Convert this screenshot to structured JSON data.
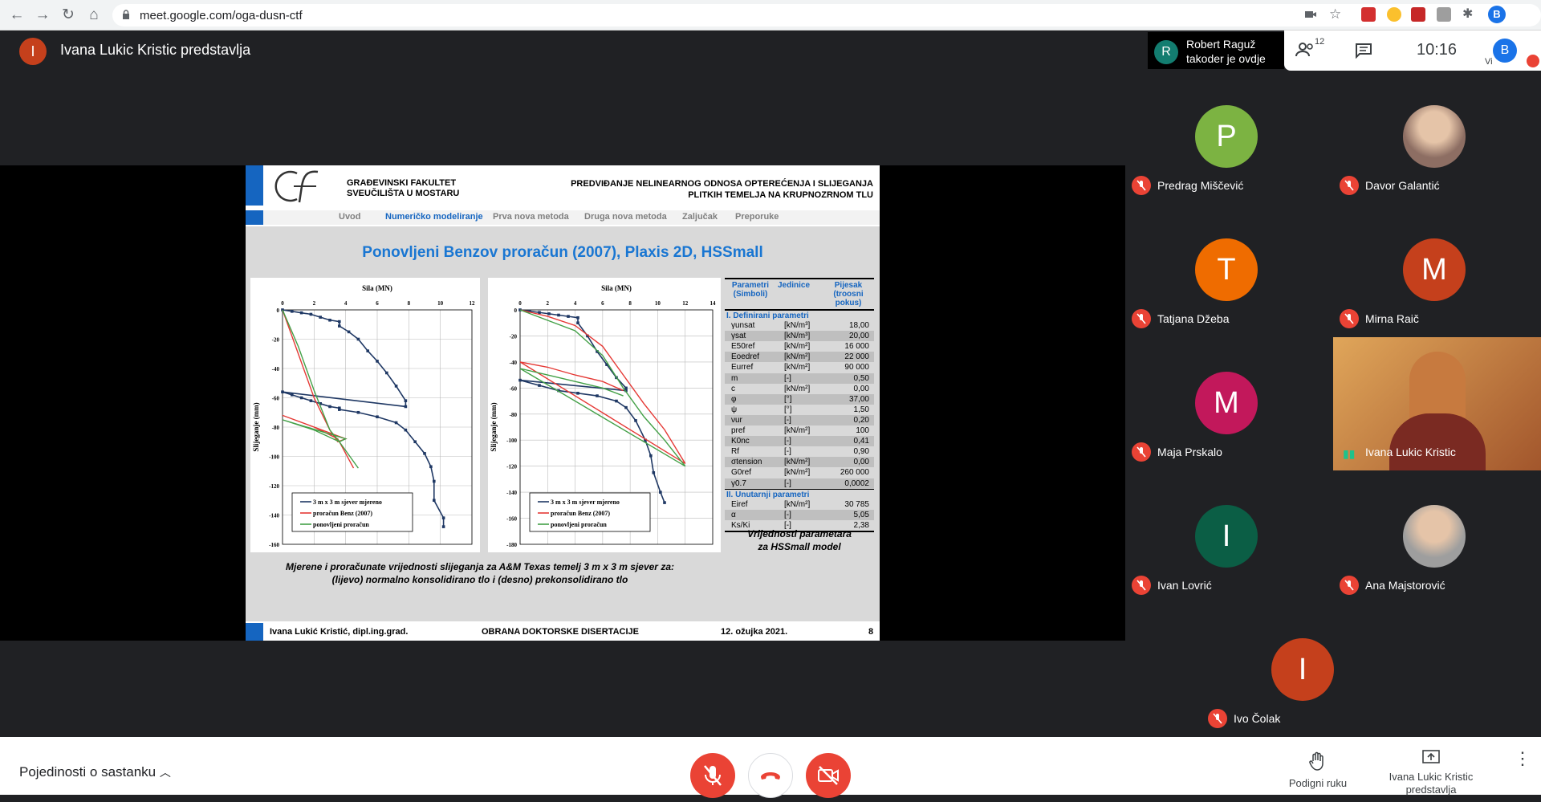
{
  "browser": {
    "url": "meet.google.com/oga-dusn-ctf",
    "profile": "B"
  },
  "presenter": {
    "initial": "I",
    "label": "Ivana Lukic Kristic predstavlja"
  },
  "notification": {
    "initial": "R",
    "name": "Robert Raguž",
    "text": "takoder je ovdje"
  },
  "topbar": {
    "people_count": "12",
    "clock": "10:16",
    "self_initial": "B",
    "self_label": "Vi"
  },
  "slide": {
    "faculty_line1": "GRAĐEVINSKI FAKULTET",
    "faculty_line2": "SVEUČILIŠTA U MOSTARU",
    "title_line1": "PREDVIĐANJE NELINEARNOG ODNOSA OPTEREĆENJA I SLIJEGANJA",
    "title_line2": "PLITKIH TEMELJA NA KRUPNOZRNOM TLU",
    "menu": [
      "Uvod",
      "Numeričko modeliranje",
      "Prva nova metoda",
      "Druga nova metoda",
      "Zaljučak",
      "Preporuke"
    ],
    "heading": "Ponovljeni Benzov proračun (2007), Plaxis 2D, HSSmall",
    "caption_line1": "Mjerene i proračunate vrijednosti slijeganja za A&M Texas temelj 3 m x 3 m sjever za:",
    "caption_line2": "(lijevo) normalno konsolidirano tlo i (desno) prekonsolidirano tlo",
    "table_caption_line1": "Vrijednosti parametara",
    "table_caption_line2": "za HSSmall model",
    "footer_author": "Ivana Lukić Kristić, dipl.ing.grad.",
    "footer_event": "OBRANA DOKTORSKE DISERTACIJE",
    "footer_date": "12. ožujka 2021.",
    "footer_page": "8",
    "table": {
      "h1": "Parametri (Simboli)",
      "h2": "Jedinice",
      "h3": "Pijesak (troosni pokus)",
      "sec1": "I. Definirani parametri",
      "rows1": [
        [
          "γunsat",
          "[kN/m³]",
          "18,00"
        ],
        [
          "γsat",
          "[kN/m³]",
          "20,00"
        ],
        [
          "E50ref",
          "[kN/m²]",
          "16 000"
        ],
        [
          "Eoedref",
          "[kN/m²]",
          "22 000"
        ],
        [
          "Eurref",
          "[kN/m²]",
          "90 000"
        ],
        [
          "m",
          "[-]",
          "0,50"
        ],
        [
          "c",
          "[kN/m²]",
          "0,00"
        ],
        [
          "φ",
          "[°]",
          "37,00"
        ],
        [
          "ψ",
          "[°]",
          "1,50"
        ],
        [
          "νur",
          "[-]",
          "0,20"
        ],
        [
          "pref",
          "[kN/m²]",
          "100"
        ],
        [
          "K0nc",
          "[-]",
          "0,41"
        ],
        [
          "Rf",
          "[-]",
          "0,90"
        ],
        [
          "σtension",
          "[kN/m²]",
          "0,00"
        ],
        [
          "G0ref",
          "[kN/m²]",
          "260 000"
        ],
        [
          "γ0.7",
          "[-]",
          "0,0002"
        ]
      ],
      "sec2": "II. Unutarnji parametri",
      "rows2": [
        [
          "Eiref",
          "[kN/m²]",
          "30 785"
        ],
        [
          "α",
          "[-]",
          "5,05"
        ],
        [
          "Ks/Ki",
          "[-]",
          "2,38"
        ]
      ]
    }
  },
  "chart_data": [
    {
      "type": "line",
      "xlabel": "Sila (MN)",
      "ylabel": "Slijeganje (mm)",
      "xlim": [
        0,
        12
      ],
      "ylim": [
        -160,
        0
      ],
      "xticks": [
        "0",
        "2",
        "4",
        "6",
        "8",
        "10",
        "12"
      ],
      "yticks": [
        "0",
        "-20",
        "-40",
        "-60",
        "-80",
        "-100",
        "-120",
        "-140",
        "-160"
      ],
      "series": [
        {
          "name": "3 m x 3 m sjever mjereno",
          "color": "#1f3864",
          "x": [
            0,
            0.6,
            1.2,
            1.8,
            2.4,
            3,
            3.6,
            3.6,
            4.2,
            4.8,
            5.4,
            6,
            6.6,
            7.2,
            7.8,
            7.8,
            0,
            0.6,
            1.2,
            1.8,
            2.4,
            3,
            3.6,
            3.6,
            4.8,
            6,
            7.2,
            7.8,
            8.4,
            9,
            9.4,
            9.6,
            9.6,
            10.2,
            10.2
          ],
          "y": [
            0,
            -1,
            -2,
            -3,
            -5,
            -7,
            -8,
            -11,
            -15,
            -20,
            -28,
            -35,
            -43,
            -52,
            -62,
            -66,
            -56,
            -58,
            -60,
            -62,
            -64,
            -66,
            -67,
            -68,
            -70,
            -73,
            -77,
            -82,
            -90,
            -98,
            -107,
            -117,
            -130,
            -142,
            -148
          ]
        },
        {
          "name": "proračun Benz (2007)",
          "color": "#e53935",
          "x": [
            0,
            1,
            2,
            3,
            3.5,
            4,
            0,
            2,
            3.5,
            4.5
          ],
          "y": [
            0,
            -30,
            -60,
            -82,
            -90,
            -88,
            -72,
            -80,
            -88,
            -108
          ]
        },
        {
          "name": "ponovljeni proračun",
          "color": "#43a047",
          "x": [
            0,
            1,
            2,
            3,
            3.6,
            4,
            0,
            2,
            3.6,
            4.8
          ],
          "y": [
            0,
            -25,
            -55,
            -82,
            -90,
            -88,
            -75,
            -82,
            -90,
            -108
          ]
        }
      ]
    },
    {
      "type": "line",
      "xlabel": "Sila (MN)",
      "ylabel": "Slijeganje (mm)",
      "xlim": [
        0,
        14
      ],
      "ylim": [
        -180,
        0
      ],
      "xticks": [
        "0",
        "2",
        "4",
        "6",
        "8",
        "10",
        "12",
        "14"
      ],
      "yticks": [
        "0",
        "-20",
        "-40",
        "-60",
        "-80",
        "-100",
        "-120",
        "-140",
        "-160",
        "-180"
      ],
      "series": [
        {
          "name": "3 m x 3 m sjever mjereno",
          "color": "#1f3864",
          "x": [
            0,
            0.7,
            1.4,
            2.1,
            2.8,
            3.5,
            4.2,
            4.2,
            4.9,
            5.6,
            6.3,
            7,
            7.7,
            7.7,
            0,
            1.4,
            2.8,
            4.2,
            5.6,
            7,
            7.7,
            8.4,
            9.1,
            9.5,
            9.7,
            10.2,
            10.5
          ],
          "y": [
            0,
            -1,
            -2,
            -3,
            -4,
            -5,
            -6,
            -10,
            -20,
            -32,
            -42,
            -52,
            -60,
            -62,
            -54,
            -58,
            -62,
            -64,
            -66,
            -70,
            -75,
            -85,
            -100,
            -112,
            -125,
            -140,
            -148
          ]
        },
        {
          "name": "proračun Benz (2007)",
          "color": "#e53935",
          "x": [
            0,
            2,
            4,
            6,
            7.5,
            9,
            10.5,
            12,
            0,
            2,
            4,
            6,
            7.5
          ],
          "y": [
            0,
            -5,
            -12,
            -28,
            -50,
            -72,
            -92,
            -118,
            -40,
            -44,
            -50,
            -55,
            -62
          ]
        },
        {
          "name": "ponovljeni proračun",
          "color": "#43a047",
          "x": [
            0,
            2,
            4,
            6,
            7.5,
            9,
            10.5,
            12,
            0,
            2,
            4,
            6,
            7.5
          ],
          "y": [
            0,
            -8,
            -16,
            -35,
            -60,
            -82,
            -100,
            -120,
            -45,
            -50,
            -55,
            -60,
            -66
          ]
        }
      ]
    }
  ],
  "participants": [
    {
      "name": "Predrag Miščević",
      "initial": "P",
      "color": "#7cb342",
      "type": "avatar"
    },
    {
      "name": "Davor Galantić",
      "initial": "D",
      "color": "#8d6e63",
      "type": "photo"
    },
    {
      "name": "Tatjana Džeba",
      "initial": "T",
      "color": "#ef6c00",
      "type": "avatar"
    },
    {
      "name": "Mirna Raič",
      "initial": "M",
      "color": "#c5401c",
      "type": "avatar"
    },
    {
      "name": "Maja Prskalo",
      "initial": "M",
      "color": "#c2185b",
      "type": "avatar"
    },
    {
      "name": "Ivana Lukic Kristic",
      "initial": "",
      "color": "#b7763c",
      "type": "video"
    },
    {
      "name": "Ivan Lovrić",
      "initial": "I",
      "color": "#0b5e45",
      "type": "avatar"
    },
    {
      "name": "Ana Majstorović",
      "initial": "A",
      "color": "#9e9e9e",
      "type": "photo"
    },
    {
      "name": "Ivo Čolak",
      "initial": "I",
      "color": "#c5401c",
      "type": "avatar"
    }
  ],
  "bottom": {
    "details": "Pojedinosti o sastanku",
    "raise_hand": "Podigni ruku",
    "presenting_line1": "Ivana Lukic Kristic",
    "presenting_line2": "predstavlja"
  },
  "colors": {
    "danger": "#ea4335",
    "accent": "#1a73e8",
    "slide_blue": "#1565c0"
  }
}
